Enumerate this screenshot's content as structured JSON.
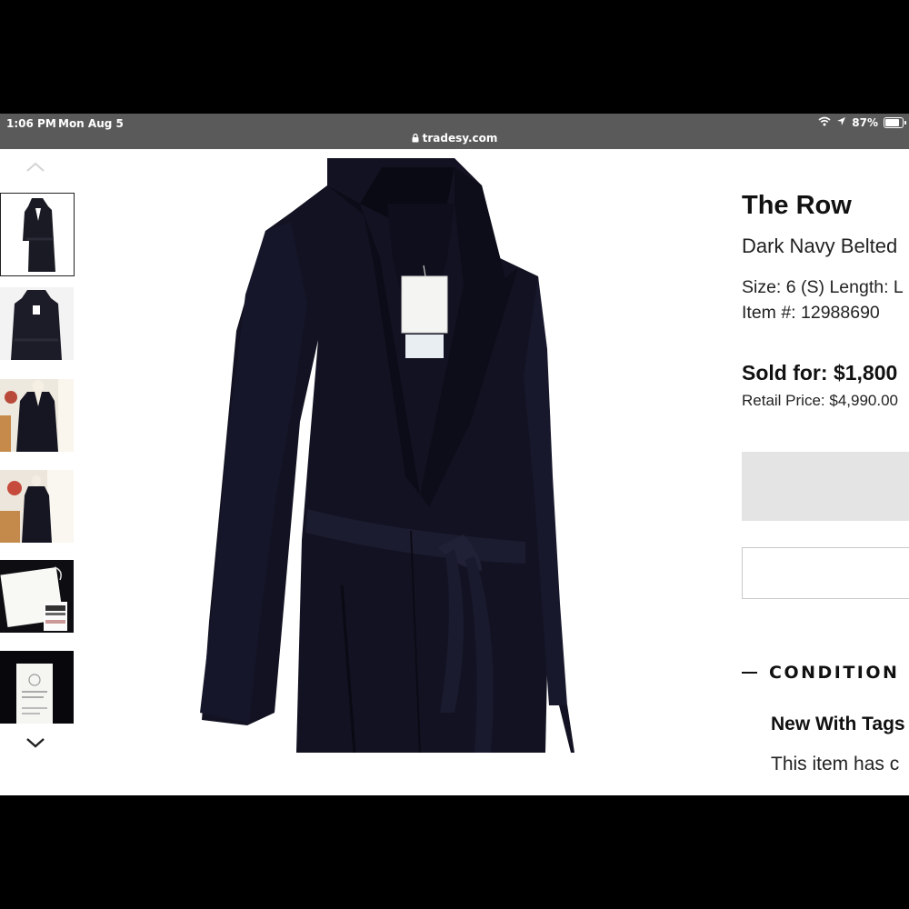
{
  "status_bar": {
    "time": "1:06 PM",
    "date": "Mon Aug 5",
    "battery": "87%",
    "url": "tradesy.com"
  },
  "thumbnails": {
    "count": 6,
    "selected_index": 0
  },
  "product": {
    "brand": "The Row",
    "title": "Dark Navy Belted",
    "size_line": "Size: 6 (S) Length: L",
    "item_line": "Item #: 12988690",
    "sold_label": "Sold for: ",
    "sold_price": "$1,800",
    "retail_line": "Retail Price: $4,990.00"
  },
  "condition": {
    "heading": "CONDITION",
    "value": "New With Tags",
    "description": "This item has c"
  },
  "colors": {
    "status_bar_bg": "#5a5a5a",
    "coat": "#1a1a2e",
    "button_gray": "#e4e4e4"
  }
}
